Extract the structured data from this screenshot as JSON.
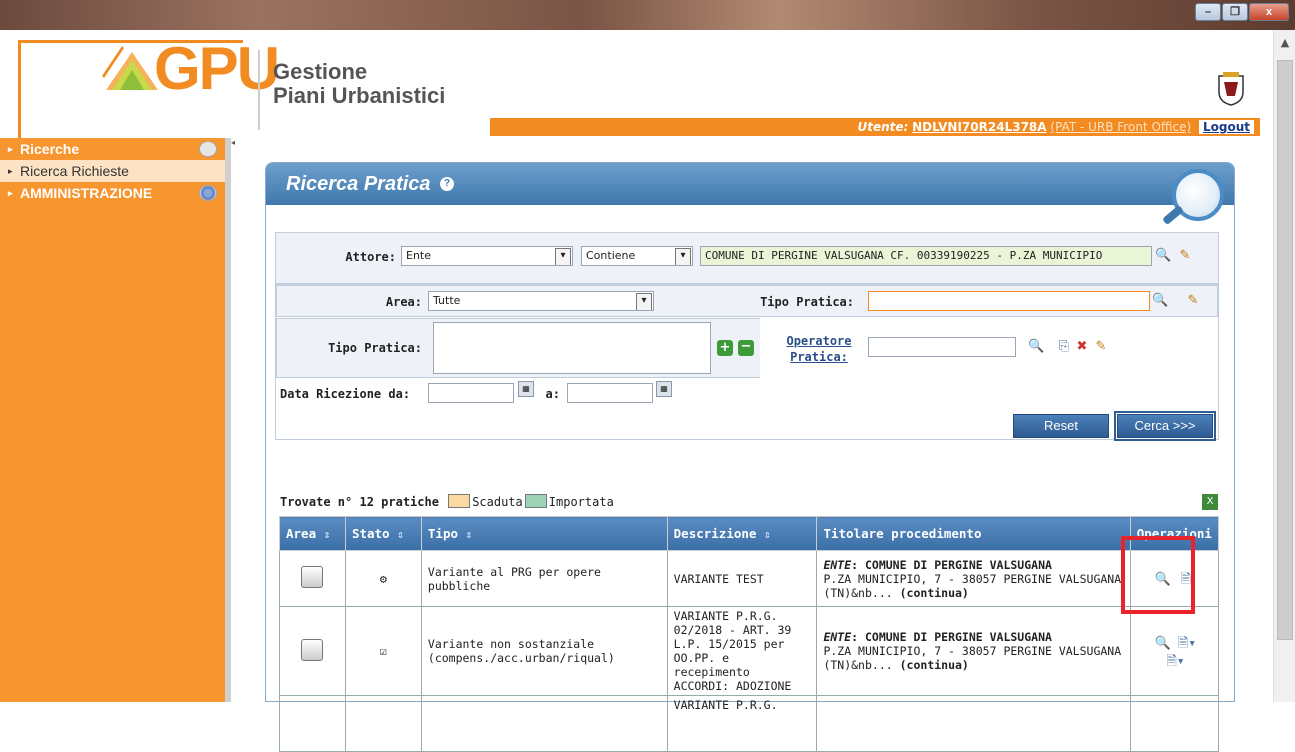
{
  "window": {
    "buttons": {
      "minimize": "–",
      "restore": "❐",
      "close": "x"
    }
  },
  "header": {
    "logo_text": "GPU",
    "app_title_line1": "Gestione",
    "app_title_line2": "Piani Urbanistici",
    "user_label": "Utente:",
    "user_name": "NDLVNI70R24L378A",
    "user_role": "(PAT - URB Front Office)",
    "logout_label": "Logout"
  },
  "sidebar": {
    "items": [
      {
        "label": "Ricerche"
      },
      {
        "label": "Ricerca Richieste"
      },
      {
        "label": "AMMINISTRAZIONE"
      }
    ]
  },
  "panel": {
    "title": "Ricerca Pratica",
    "help": "?"
  },
  "attore": {
    "label": "Attore:",
    "select_value": "Ente",
    "match_value": "Contiene",
    "text_value": "COMUNE DI PERGINE VALSUGANA CF. 00339190225 - P.ZA MUNICIPIO"
  },
  "filters": {
    "area_label": "Area:",
    "area_value": "Tutte",
    "tipo_pratica_label": "Tipo Pratica:",
    "tipo_pratica_text": "",
    "tipo_pratica_list_label": "Tipo Pratica:",
    "operatore_label_1": "Operatore",
    "operatore_label_2": "Pratica:",
    "operatore_value": "",
    "data_da_label": "Data Ricezione da:",
    "data_a_label": "a:",
    "data_da_value": "",
    "data_a_value": ""
  },
  "buttons": {
    "reset": "Reset",
    "cerca": "Cerca >>>"
  },
  "results": {
    "found_text": "Trovate n° 12 pratiche",
    "legend": [
      {
        "label": "Scaduta",
        "color": "#fcd9a0"
      },
      {
        "label": "Importata",
        "color": "#9fd3b8"
      }
    ],
    "columns": [
      "Area",
      "Stato",
      "Tipo",
      "Descrizione",
      "Titolare procedimento",
      "Operazioni"
    ],
    "rows": [
      {
        "tipo": "Variante al PRG per opere pubbliche",
        "descrizione": "VARIANTE TEST",
        "titolare_prefix": "ENTE",
        "titolare_name": ": COMUNE DI PERGINE VALSUGANA",
        "titolare_address": "P.ZA MUNICIPIO, 7 - 38057 PERGINE VALSUGANA (TN)&nb...",
        "titolare_more": "(continua)"
      },
      {
        "tipo": "Variante non sostanziale (compens./acc.urban/riqual)",
        "descrizione": "VARIANTE P.R.G. 02/2018 - ART. 39 L.P. 15/2015 per OO.PP. e recepimento ACCORDI: ADOZIONE",
        "titolare_prefix": "ENTE",
        "titolare_name": ": COMUNE DI PERGINE VALSUGANA",
        "titolare_address": "P.ZA MUNICIPIO, 7 - 38057 PERGINE VALSUGANA (TN)&nb...",
        "titolare_more": "(continua)"
      },
      {
        "tipo": "",
        "descrizione": "VARIANTE P.R.G.",
        "titolare_prefix": "",
        "titolare_name": "",
        "titolare_address": "",
        "titolare_more": ""
      }
    ]
  }
}
